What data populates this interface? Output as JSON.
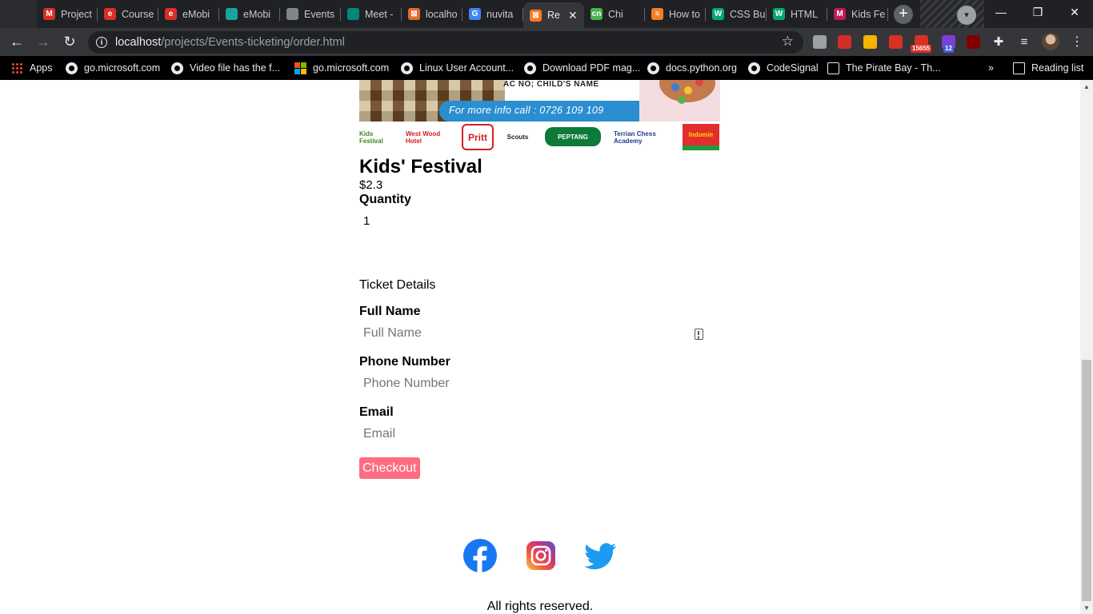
{
  "browser": {
    "tabs": [
      {
        "title": "Project",
        "favicon": "gmail-icon",
        "color": "#d93025"
      },
      {
        "title": "Course",
        "favicon": "e-icon",
        "color": "#d93025"
      },
      {
        "title": "eMobi",
        "favicon": "e-icon",
        "color": "#d93025"
      },
      {
        "title": "eMobi",
        "favicon": "teal-circle-icon",
        "color": "#1aa39a"
      },
      {
        "title": "Events",
        "favicon": "globe-icon",
        "color": "#80868b"
      },
      {
        "title": "Meet -",
        "favicon": "meet-icon",
        "color": "#00897b"
      },
      {
        "title": "localho",
        "favicon": "xampp-icon",
        "color": "#e66a2c"
      },
      {
        "title": "nuvita",
        "favicon": "google-icon",
        "color": "#4285f4"
      },
      {
        "title": "Re",
        "favicon": "xampp-icon",
        "color": "#fb7a24",
        "active": true
      },
      {
        "title": "Chi",
        "favicon": "cn-icon",
        "color": "#4caf50"
      },
      {
        "title": "How to",
        "favicon": "stack-icon",
        "color": "#f48024"
      },
      {
        "title": "CSS Bu",
        "favicon": "w3-icon",
        "color": "#04aa6d"
      },
      {
        "title": "HTML",
        "favicon": "w3-icon",
        "color": "#04aa6d"
      },
      {
        "title": "Kids Fe",
        "favicon": "m-icon",
        "color": "#c2185b"
      }
    ],
    "active_tab_close": "✕",
    "new_tab": "+",
    "window_buttons": {
      "minimize": "—",
      "restore": "❐",
      "close": "✕"
    },
    "url_host": "localhost",
    "url_path": "/projects/Events-ticketing/order.html",
    "extensions": [
      {
        "name": "ext-gray-icon",
        "color": "#9aa0a6"
      },
      {
        "name": "ext-lastpass-icon",
        "color": "#d32d27"
      },
      {
        "name": "ext-colorful-icon",
        "color": "#f4b400"
      },
      {
        "name": "ext-pen-icon",
        "color": "#d93025"
      },
      {
        "name": "ext-mail-icon",
        "color": "#d93025",
        "badge": "15655"
      },
      {
        "name": "ext-purple-icon",
        "color": "#7b3fd6",
        "badge": "12"
      },
      {
        "name": "ext-ublock-icon",
        "color": "#800000"
      }
    ],
    "bookmarks": [
      {
        "label": "Apps",
        "icon": "apps"
      },
      {
        "label": "go.microsoft.com",
        "icon": "globe"
      },
      {
        "label": "Video file has the f...",
        "icon": "globe"
      },
      {
        "label": "go.microsoft.com",
        "icon": "ms"
      },
      {
        "label": "Linux User Account...",
        "icon": "globe"
      },
      {
        "label": "Download PDF mag...",
        "icon": "globe"
      },
      {
        "label": "docs.python.org",
        "icon": "globe"
      },
      {
        "label": "CodeSignal",
        "icon": "globe"
      },
      {
        "label": "The Pirate Bay - Th...",
        "icon": "pb"
      }
    ],
    "bookmarks_more": "»",
    "reading_list": "Reading list"
  },
  "banner": {
    "child_name": "AC NO; CHILD'S NAME",
    "info": "For more info call : 0726 109 109",
    "sponsors": [
      "Kids Festival",
      "West Wood Hotel",
      "Pritt",
      "Scouts",
      "PEPTANG",
      "Terrian Chess Academy",
      "Indomie"
    ]
  },
  "event": {
    "title": "Kids' Festival",
    "price": "$2.3",
    "quantity_label": "Quantity",
    "quantity_value": "1"
  },
  "ticket": {
    "section_title": "Ticket Details",
    "full_name_label": "Full Name",
    "full_name_placeholder": "Full Name",
    "phone_label": "Phone Number",
    "phone_placeholder": "Phone Number",
    "email_label": "Email",
    "email_placeholder": "Email",
    "checkout_label": "Checkout"
  },
  "footer": {
    "copyright": "All rights reserved."
  }
}
